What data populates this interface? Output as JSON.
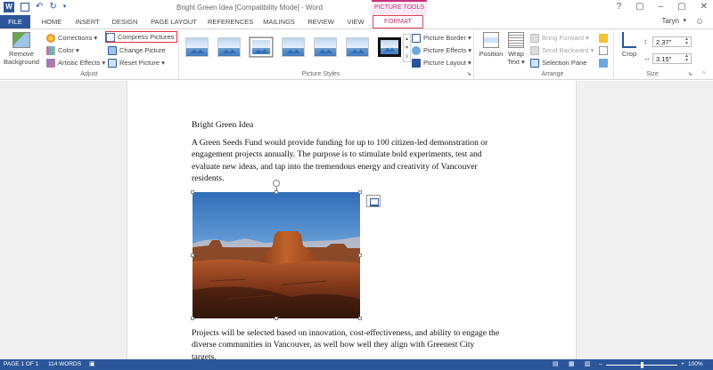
{
  "window": {
    "title": "Bright Green Idea [Compatibility Mode] - Word",
    "context_tab_group": "PICTURE TOOLS",
    "controls": [
      "?",
      "▢",
      "–",
      "▢",
      "✕"
    ]
  },
  "quick_access": {
    "word_logo": "W",
    "undo": "↶",
    "redo": "↻",
    "customize": "▾"
  },
  "tabs": [
    "HOME",
    "INSERT",
    "DESIGN",
    "PAGE LAYOUT",
    "REFERENCES",
    "MAILINGS",
    "REVIEW",
    "VIEW"
  ],
  "file_tab": "FILE",
  "format_tab": "FORMAT",
  "user": {
    "name": "Taryn",
    "caret": "▾"
  },
  "ribbon": {
    "adjust": {
      "remove_background_line1": "Remove",
      "remove_background_line2": "Background",
      "corrections": "Corrections ▾",
      "color": "Color ▾",
      "artistic_effects": "Artistic Effects ▾",
      "compress_pictures": "Compress Pictures",
      "change_picture": "Change Picture",
      "reset_picture": "Reset Picture ▾",
      "label": "Adjust"
    },
    "picture_styles": {
      "label": "Picture Styles",
      "picture_border": "Picture Border ▾",
      "picture_effects": "Picture Effects ▾",
      "picture_layout": "Picture Layout ▾",
      "scroll_up": "▴",
      "scroll_down": "▾"
    },
    "arrange": {
      "label": "Arrange",
      "position": "Position",
      "wrap_text_line1": "Wrap",
      "wrap_text_line2": "Text ▾",
      "bring_forward": "Bring Forward ▾",
      "send_backward": "Send Backward ▾",
      "selection_pane": "Selection Pane"
    },
    "size": {
      "label": "Size",
      "crop": "Crop",
      "height": "2.37\"",
      "width": "3.15\""
    }
  },
  "document": {
    "heading": "Bright Green Idea",
    "paragraph1": [
      "A Green Seeds Fund would provide funding for up to 100 citizen-led demonstration or",
      "engagement projects annually. The purpose is to stimulate bold experiments, test and",
      "evaluate new ideas, and tap into the tremendous energy and creativity of Vancouver",
      "residents."
    ],
    "paragraph2": [
      "Projects will be selected based on innovation, cost-effectiveness, and ability to engage the",
      "diverse communities in Vancouver, as well how well they align with Greenest City",
      "targets."
    ]
  },
  "status": {
    "page": "PAGE 1 OF 1",
    "words": "114 WORDS",
    "zoom_minus": "–",
    "zoom_plus": "+",
    "zoom": "100%"
  },
  "colors": {
    "word_blue": "#2b579a",
    "picture_tools_pink": "#c6337c",
    "highlight_red": "#e0303a"
  }
}
